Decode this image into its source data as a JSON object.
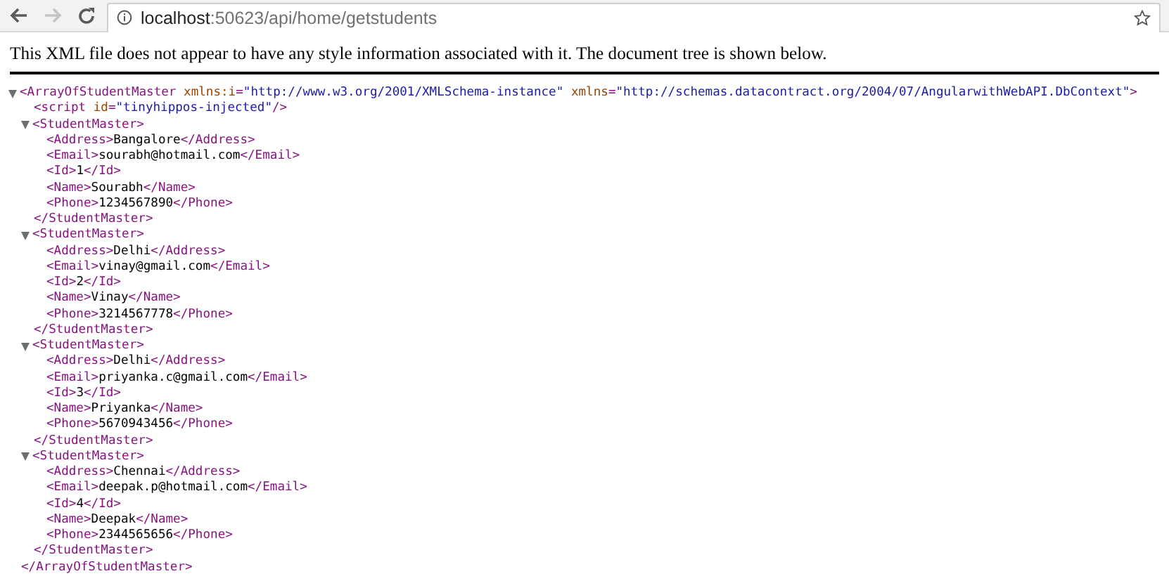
{
  "toolbar": {
    "back_disabled": false,
    "forward_disabled": true,
    "address": {
      "host": "localhost",
      "path": ":50623/api/home/getstudents"
    },
    "bookmarked": false
  },
  "notice": "This XML file does not appear to have any style information associated with it. The document tree is shown below.",
  "tree": {
    "expanded": true,
    "line": [
      {
        "kind": "tag",
        "text": "<ArrayOfStudentMaster"
      },
      {
        "kind": "attr",
        "text": " xmlns:i"
      },
      {
        "kind": "tag",
        "text": "="
      },
      {
        "kind": "value",
        "text": "\"http://www.w3.org/2001/XMLSchema-instance\""
      },
      {
        "kind": "attr",
        "text": " xmlns"
      },
      {
        "kind": "tag",
        "text": "="
      },
      {
        "kind": "value",
        "text": "\"http://schemas.datacontract.org/2004/07/AngularwithWebAPI.DbContext\""
      },
      {
        "kind": "tag",
        "text": ">"
      }
    ],
    "children": [
      {
        "line": [
          {
            "kind": "tag",
            "text": "<script"
          },
          {
            "kind": "attr",
            "text": " id"
          },
          {
            "kind": "tag",
            "text": "="
          },
          {
            "kind": "value",
            "text": "\"tinyhippos-injected\""
          },
          {
            "kind": "tag",
            "text": "/>"
          }
        ]
      },
      {
        "expanded": true,
        "line": [
          {
            "kind": "tag",
            "text": "<StudentMaster>"
          }
        ],
        "children": [
          {
            "line": [
              {
                "kind": "tag",
                "text": "<Address>"
              },
              {
                "kind": "text",
                "text": "Bangalore"
              },
              {
                "kind": "tag",
                "text": "</Address>"
              }
            ]
          },
          {
            "line": [
              {
                "kind": "tag",
                "text": "<Email>"
              },
              {
                "kind": "text",
                "text": "sourabh@hotmail.com"
              },
              {
                "kind": "tag",
                "text": "</Email>"
              }
            ]
          },
          {
            "line": [
              {
                "kind": "tag",
                "text": "<Id>"
              },
              {
                "kind": "text",
                "text": "1"
              },
              {
                "kind": "tag",
                "text": "</Id>"
              }
            ]
          },
          {
            "line": [
              {
                "kind": "tag",
                "text": "<Name>"
              },
              {
                "kind": "text",
                "text": "Sourabh"
              },
              {
                "kind": "tag",
                "text": "</Name>"
              }
            ]
          },
          {
            "line": [
              {
                "kind": "tag",
                "text": "<Phone>"
              },
              {
                "kind": "text",
                "text": "1234567890"
              },
              {
                "kind": "tag",
                "text": "</Phone>"
              }
            ]
          }
        ],
        "close": [
          {
            "kind": "tag",
            "text": "</StudentMaster>"
          }
        ]
      },
      {
        "expanded": true,
        "line": [
          {
            "kind": "tag",
            "text": "<StudentMaster>"
          }
        ],
        "children": [
          {
            "line": [
              {
                "kind": "tag",
                "text": "<Address>"
              },
              {
                "kind": "text",
                "text": "Delhi"
              },
              {
                "kind": "tag",
                "text": "</Address>"
              }
            ]
          },
          {
            "line": [
              {
                "kind": "tag",
                "text": "<Email>"
              },
              {
                "kind": "text",
                "text": "vinay@gmail.com"
              },
              {
                "kind": "tag",
                "text": "</Email>"
              }
            ]
          },
          {
            "line": [
              {
                "kind": "tag",
                "text": "<Id>"
              },
              {
                "kind": "text",
                "text": "2"
              },
              {
                "kind": "tag",
                "text": "</Id>"
              }
            ]
          },
          {
            "line": [
              {
                "kind": "tag",
                "text": "<Name>"
              },
              {
                "kind": "text",
                "text": "Vinay"
              },
              {
                "kind": "tag",
                "text": "</Name>"
              }
            ]
          },
          {
            "line": [
              {
                "kind": "tag",
                "text": "<Phone>"
              },
              {
                "kind": "text",
                "text": "3214567778"
              },
              {
                "kind": "tag",
                "text": "</Phone>"
              }
            ]
          }
        ],
        "close": [
          {
            "kind": "tag",
            "text": "</StudentMaster>"
          }
        ]
      },
      {
        "expanded": true,
        "line": [
          {
            "kind": "tag",
            "text": "<StudentMaster>"
          }
        ],
        "children": [
          {
            "line": [
              {
                "kind": "tag",
                "text": "<Address>"
              },
              {
                "kind": "text",
                "text": "Delhi"
              },
              {
                "kind": "tag",
                "text": "</Address>"
              }
            ]
          },
          {
            "line": [
              {
                "kind": "tag",
                "text": "<Email>"
              },
              {
                "kind": "text",
                "text": "priyanka.c@gmail.com"
              },
              {
                "kind": "tag",
                "text": "</Email>"
              }
            ]
          },
          {
            "line": [
              {
                "kind": "tag",
                "text": "<Id>"
              },
              {
                "kind": "text",
                "text": "3"
              },
              {
                "kind": "tag",
                "text": "</Id>"
              }
            ]
          },
          {
            "line": [
              {
                "kind": "tag",
                "text": "<Name>"
              },
              {
                "kind": "text",
                "text": "Priyanka"
              },
              {
                "kind": "tag",
                "text": "</Name>"
              }
            ]
          },
          {
            "line": [
              {
                "kind": "tag",
                "text": "<Phone>"
              },
              {
                "kind": "text",
                "text": "5670943456"
              },
              {
                "kind": "tag",
                "text": "</Phone>"
              }
            ]
          }
        ],
        "close": [
          {
            "kind": "tag",
            "text": "</StudentMaster>"
          }
        ]
      },
      {
        "expanded": true,
        "line": [
          {
            "kind": "tag",
            "text": "<StudentMaster>"
          }
        ],
        "children": [
          {
            "line": [
              {
                "kind": "tag",
                "text": "<Address>"
              },
              {
                "kind": "text",
                "text": "Chennai"
              },
              {
                "kind": "tag",
                "text": "</Address>"
              }
            ]
          },
          {
            "line": [
              {
                "kind": "tag",
                "text": "<Email>"
              },
              {
                "kind": "text",
                "text": "deepak.p@hotmail.com"
              },
              {
                "kind": "tag",
                "text": "</Email>"
              }
            ]
          },
          {
            "line": [
              {
                "kind": "tag",
                "text": "<Id>"
              },
              {
                "kind": "text",
                "text": "4"
              },
              {
                "kind": "tag",
                "text": "</Id>"
              }
            ]
          },
          {
            "line": [
              {
                "kind": "tag",
                "text": "<Name>"
              },
              {
                "kind": "text",
                "text": "Deepak"
              },
              {
                "kind": "tag",
                "text": "</Name>"
              }
            ]
          },
          {
            "line": [
              {
                "kind": "tag",
                "text": "<Phone>"
              },
              {
                "kind": "text",
                "text": "2344565656"
              },
              {
                "kind": "tag",
                "text": "</Phone>"
              }
            ]
          }
        ],
        "close": [
          {
            "kind": "tag",
            "text": "</StudentMaster>"
          }
        ]
      }
    ],
    "close": [
      {
        "kind": "tag",
        "text": "</ArrayOfStudentMaster>"
      }
    ]
  }
}
